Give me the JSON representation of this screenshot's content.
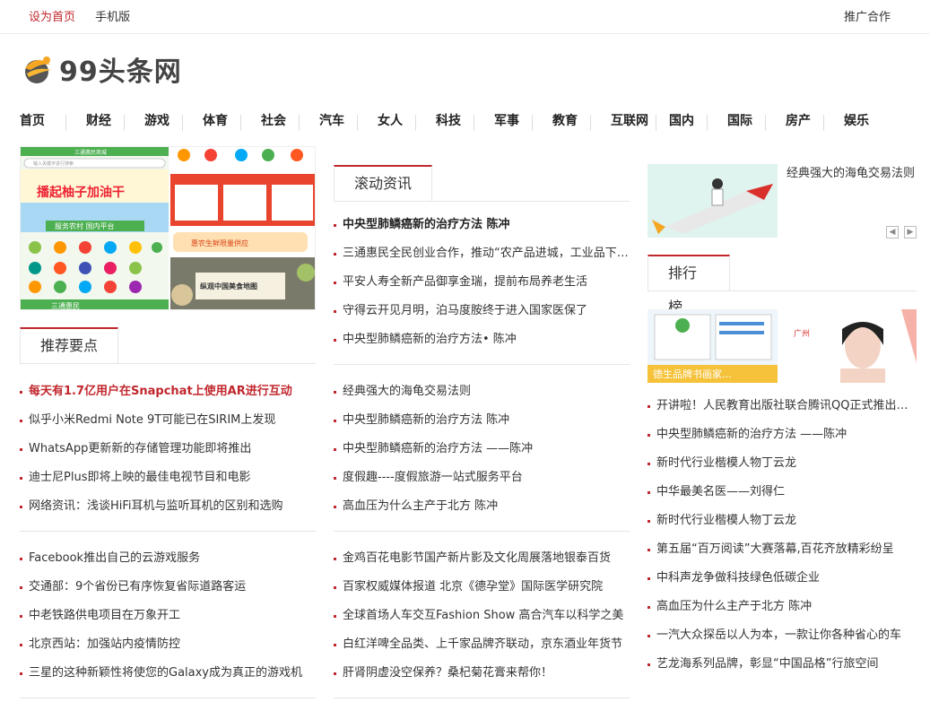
{
  "topbar": {
    "set_home": "设为首页",
    "mobile": "手机版",
    "promote": "推广合作"
  },
  "logo": {
    "text": "99头条网"
  },
  "nav": [
    "首页",
    "财经",
    "游戏",
    "体育",
    "社会",
    "汽车",
    "女人",
    "科技",
    "军事",
    "教育",
    "互联网",
    "国内",
    "国际",
    "房产",
    "娱乐"
  ],
  "banner": {
    "app_name": "三通惠民商城",
    "search_placeholder": "输入关键字进行搜索",
    "slogan": "播起柚子加油干",
    "sub": "服务农村 国内平台",
    "bottom_brand": "三通惠民",
    "food_map": "纵观中国美食地图",
    "promo": "惠农生鲜限量供应"
  },
  "sections": {
    "recommend": "推荐要点",
    "scroll_news": "滚动资讯",
    "ranking": "排行榜"
  },
  "recommend_list_1": [
    "每天有1.7亿用户在Snapchat上使用AR进行互动",
    "似乎小米Redmi Note 9T可能已在SIRIM上发现",
    "WhatsApp更新新的存储管理功能即将推出",
    "迪士尼Plus即将上映的最佳电视节目和电影",
    "网络资讯：浅谈HiFi耳机与监听耳机的区别和选购"
  ],
  "recommend_list_2": [
    "Facebook推出自己的云游戏服务",
    "交通部：9个省份已有序恢复省际道路客运",
    "中老铁路供电项目在万象开工",
    "北京西站：加强站内疫情防控",
    "三星的这种新颖性将使您的Galaxy成为真正的游戏机"
  ],
  "scroll_list_1": [
    "中央型肺鳞癌新的治疗方法 陈冲",
    "三通惠民全民创业合作，推动“农产品进城，工业品下乡”",
    "平安人寿全新产品御享金瑞，提前布局养老生活",
    "守得云开见月明，泊马度胺终于进入国家医保了",
    "中央型肺鳞癌新的治疗方法• 陈冲"
  ],
  "scroll_list_2": [
    "经典强大的海龟交易法则",
    "中央型肺鳞癌新的治疗方法 陈冲",
    "中央型肺鳞癌新的治疗方法 ——陈冲",
    "度假趣----度假旅游一站式服务平台",
    "高血压为什么主产于北方 陈冲"
  ],
  "scroll_list_3": [
    "金鸡百花电影节国产新片影及文化周展落地银泰百货",
    "百家权威媒体报道 北京《德孕堂》国际医学研究院",
    "全球首场人车交互Fashion Show 高合汽车以科学之美",
    "白红洋啤全品类、上千家品牌齐联动，京东酒业年货节",
    "肝肾阴虚没空保养？桑杞菊花膏来帮你！"
  ],
  "featured": {
    "title": "经典强大的海龟交易法则"
  },
  "rank_images": {
    "left_caption": "德生品牌书画家...",
    "right_caption": "广州"
  },
  "rank_list": [
    "开讲啦！人民教育出版社联合腾讯QQ正式推出在线课堂",
    "中央型肺鳞癌新的治疗方法 ——陈冲",
    "新时代行业楷模人物丁云龙",
    "中华最美名医——刘得仁",
    "新时代行业楷模人物丁云龙",
    "第五届“百万阅读”大赛落幕,百花齐放精彩纷呈",
    "中科声龙争做科技绿色低碳企业",
    "高血压为什么主产于北方 陈冲",
    "一汽大众探岳以人为本，一款让你各种省心的车",
    "艺龙海系列品牌，彰显“中国品格”行旅空间"
  ],
  "colors": {
    "accent": "#c0272d",
    "text": "#333333",
    "border": "#e5e5e5"
  }
}
